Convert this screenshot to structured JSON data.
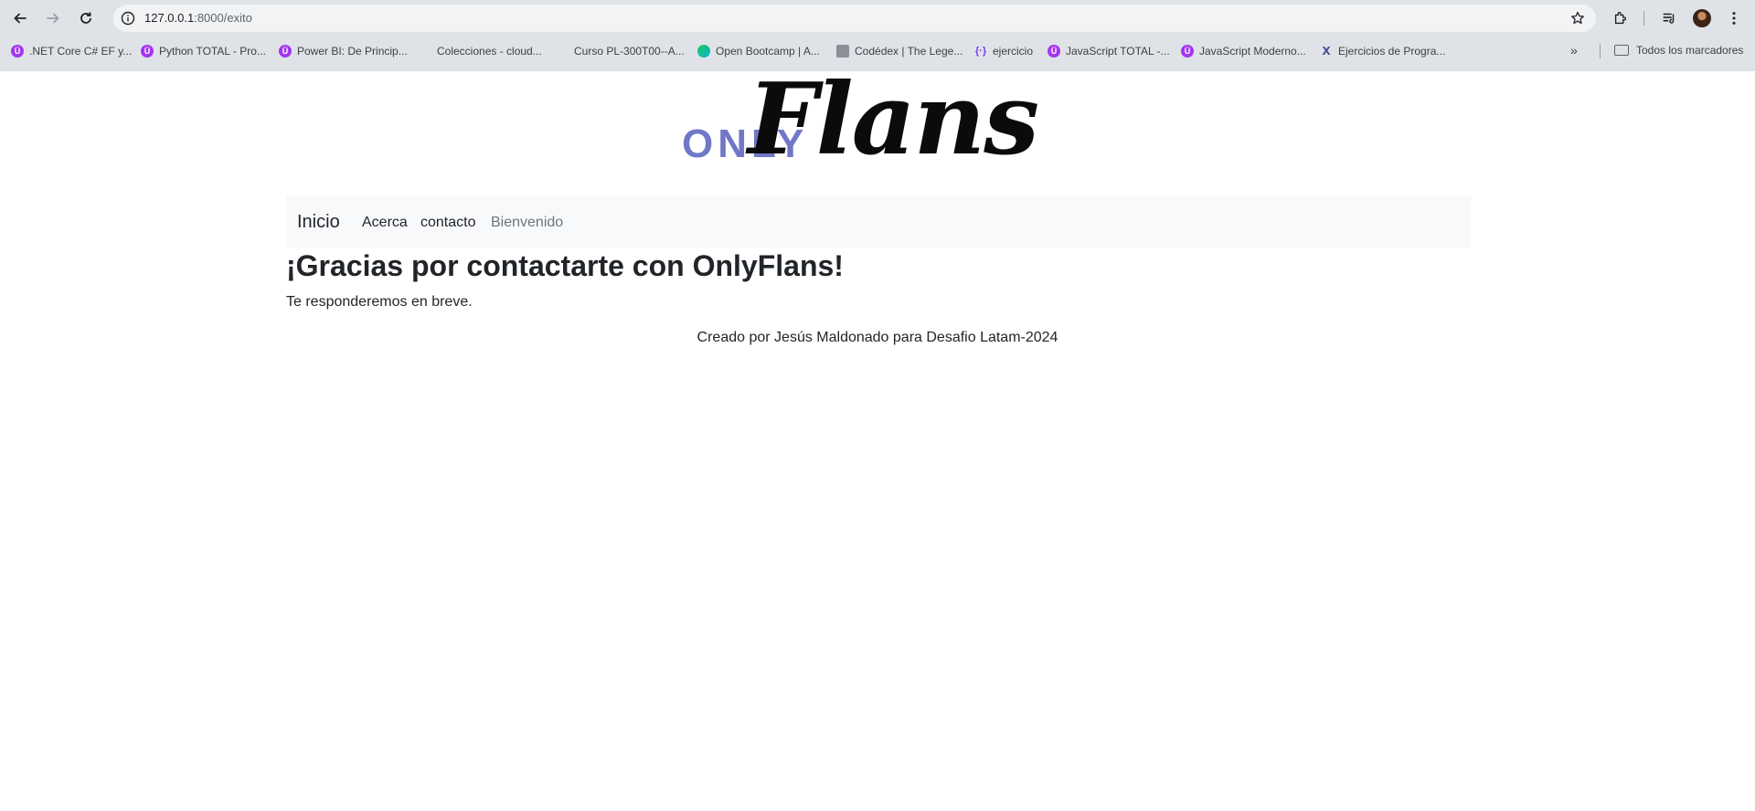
{
  "browser": {
    "url_host": "127.0.0.1",
    "url_path": ":8000/exito",
    "bookmarks": [
      {
        "label": ".NET Core C# EF y...",
        "icon": "udemy-icon"
      },
      {
        "label": "Python TOTAL - Pro...",
        "icon": "udemy-icon"
      },
      {
        "label": "Power BI: De Princip...",
        "icon": "udemy-icon"
      },
      {
        "label": "Colecciones - cloud...",
        "icon": "microsoft-icon"
      },
      {
        "label": "Curso PL-300T00--A...",
        "icon": "microsoft-icon"
      },
      {
        "label": "Open Bootcamp | A...",
        "icon": "openbootcamp-icon"
      },
      {
        "label": "Codédex | The Lege...",
        "icon": "codedex-icon"
      },
      {
        "label": "ejercicio",
        "icon": "curly-braces-icon"
      },
      {
        "label": "JavaScript TOTAL -...",
        "icon": "udemy-icon"
      },
      {
        "label": "JavaScript Moderno...",
        "icon": "udemy-icon"
      },
      {
        "label": "Ejercicios de Progra...",
        "icon": "flask-icon"
      }
    ],
    "more_bookmarks": "»",
    "all_bookmarks_label": "Todos los marcadores"
  },
  "site": {
    "logo_only": "ONLY",
    "logo_flans": "Flans",
    "nav": {
      "brand": "Inicio",
      "links": [
        "Acerca",
        "contacto",
        "Bienvenido"
      ]
    },
    "heading": "¡Gracias por contactarte con OnlyFlans!",
    "message": "Te responderemos en breve.",
    "footer": "Creado por Jesús Maldonado para Desafio Latam-2024"
  },
  "colors": {
    "logo_only": "#7177c7",
    "navbar_bg": "#f8f9fa",
    "muted_link": "#6c757d"
  }
}
